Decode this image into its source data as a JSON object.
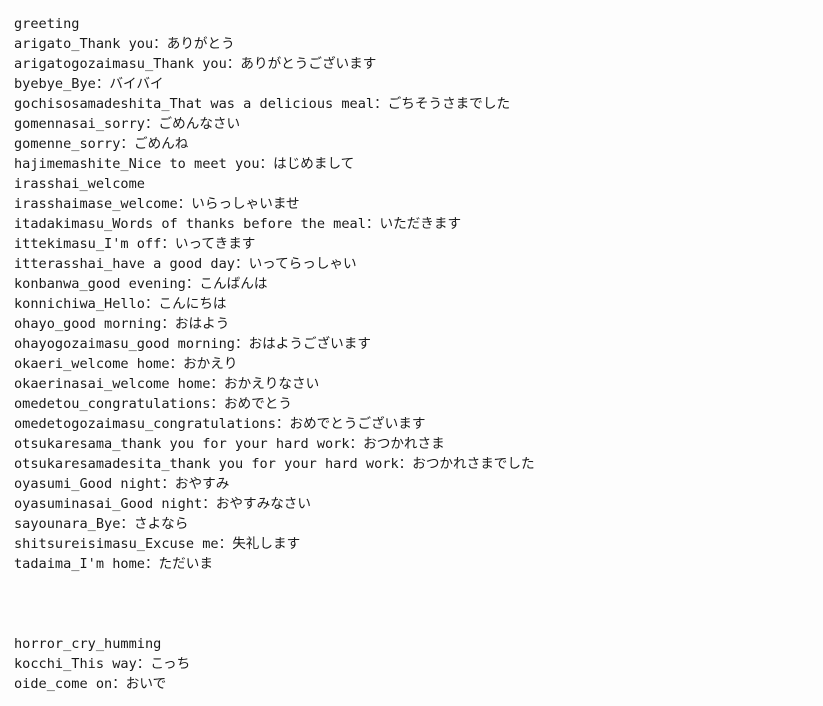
{
  "document": {
    "kind": "plain-text-listing",
    "background_color": "#fdfdfd",
    "text_color": "#1a1a1a",
    "groups": [
      {
        "name": "greeting",
        "header": "greeting",
        "lines": [
          "greeting",
          "arigato_Thank you：ありがとう",
          "arigatogozaimasu_Thank you：ありがとうございます",
          "byebye_Bye：バイバイ",
          "gochisosamadeshita_That was a delicious meal：ごちそうさまでした",
          "gomennasai_sorry：ごめんなさい",
          "gomenne_sorry：ごめんね",
          "hajimemashite_Nice to meet you：はじめまして",
          "irasshai_welcome",
          "irasshaimase_welcome：いらっしゃいませ",
          "itadakimasu_Words of thanks before the meal：いただきます",
          "ittekimasu_I'm off：いってきます",
          "itterasshai_have a good day：いってらっしゃい",
          "konbanwa_good evening：こんばんは",
          "konnichiwa_Hello：こんにちは",
          "ohayo_good morning：おはよう",
          "ohayogozaimasu_good morning：おはようございます",
          "okaeri_welcome home：おかえり",
          "okaerinasai_welcome home：おかえりなさい",
          "omedetou_congratulations：おめでとう",
          "omedetogozaimasu_congratulations：おめでとうございます",
          "otsukaresama_thank you for your hard work：おつかれさま",
          "otsukaresamadesita_thank you for your hard work：おつかれさまでした",
          "oyasumi_Good night：おやすみ",
          "oyasuminasai_Good night：おやすみなさい",
          "sayounara_Bye：さよなら",
          "shitsureisimasu_Excuse me：失礼します",
          "tadaima_I'm home：ただいま"
        ]
      },
      {
        "name": "horror_cry_humming",
        "header": "horror_cry_humming",
        "lines": [
          "horror_cry_humming",
          "kocchi_This way：こっち",
          "oide_come on：おいで"
        ]
      }
    ]
  }
}
